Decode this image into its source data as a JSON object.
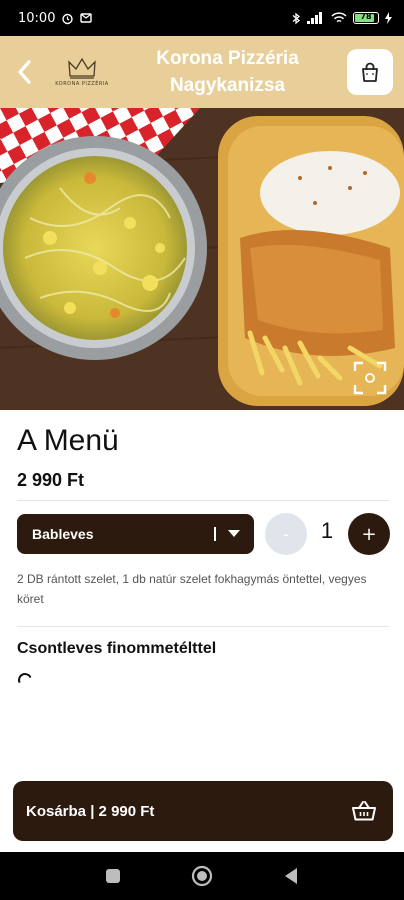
{
  "status_bar": {
    "time": "10:00",
    "battery": "78"
  },
  "header": {
    "logo_text": "KORONA PIZZÉRIA",
    "title_line1": "Korona Pizzéria",
    "title_line2": "Nagykanizsa"
  },
  "product": {
    "name": "A Menü",
    "price": "2 990 Ft",
    "selected_option": "Bableves",
    "quantity": "1",
    "minus_label": "-",
    "plus_label": "+",
    "description": "2 DB rántott szelet, 1 db natúr szelet fokhagymás öntettel, vegyes köret"
  },
  "section": {
    "title": "Csontleves finommetélttel"
  },
  "cart_bar": {
    "label": "Kosárba | 2 990 Ft"
  },
  "colors": {
    "header_bg": "#e8cf9a",
    "brand_dark": "#2d1a0f",
    "qty_disabled": "#dfe5ea"
  },
  "icons": {
    "back": "chevron-left-icon",
    "cart": "shopping-bag-icon",
    "expand": "fullscreen-icon",
    "basket": "basket-icon"
  }
}
